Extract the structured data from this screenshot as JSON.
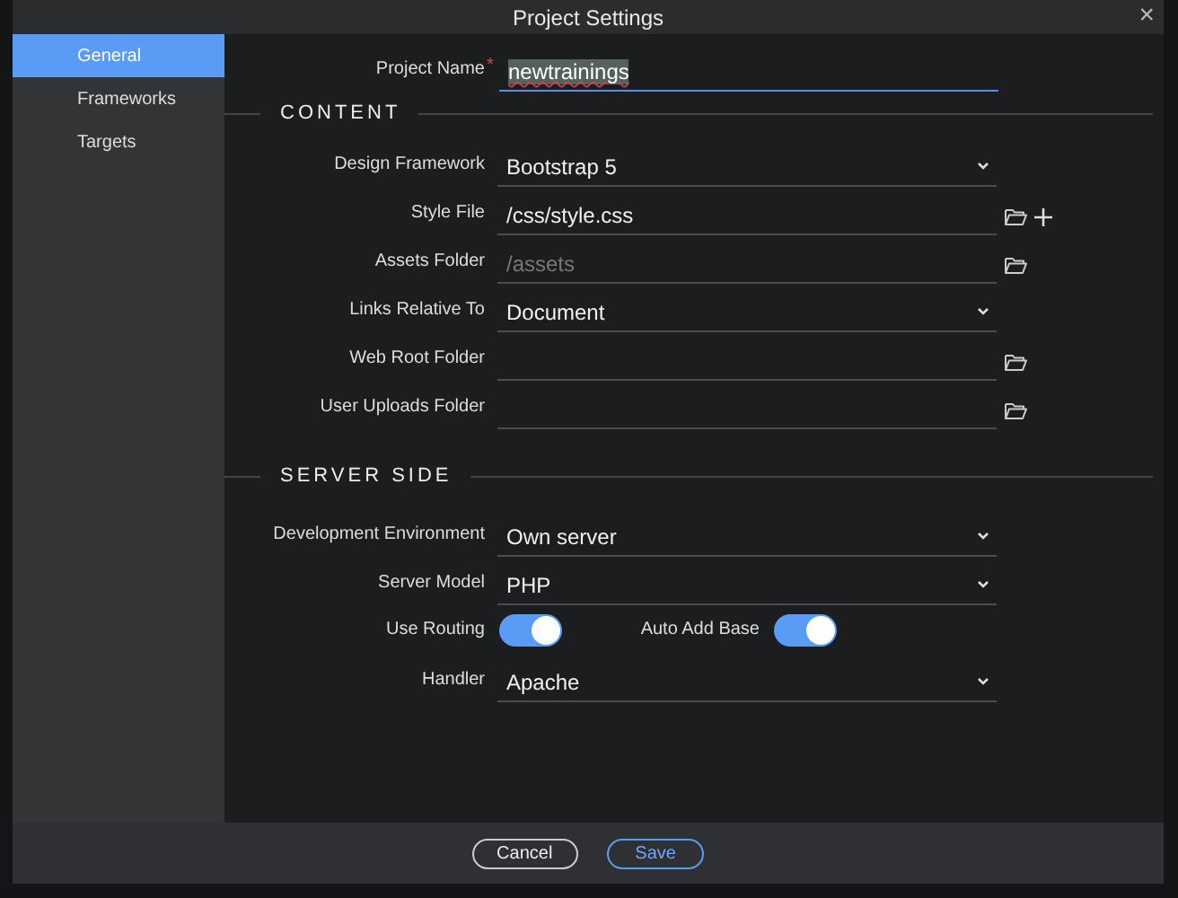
{
  "window": {
    "title": "Project Settings",
    "close": "×"
  },
  "sidebar": {
    "items": [
      {
        "label": "General",
        "selected": true
      },
      {
        "label": "Frameworks",
        "selected": false
      },
      {
        "label": "Targets",
        "selected": false
      }
    ]
  },
  "project_name": {
    "label": "Project Name",
    "required_mark": "*",
    "value": "newtrainings"
  },
  "sections": [
    {
      "title": "CONTENT",
      "rows": [
        {
          "kind": "select",
          "label": "Design Framework",
          "value": "Bootstrap 5"
        },
        {
          "kind": "file",
          "label": "Style File",
          "value": "/css/style.css",
          "addable": true
        },
        {
          "kind": "file",
          "label": "Assets Folder",
          "placeholder": "/assets",
          "addable": false
        },
        {
          "kind": "select",
          "label": "Links Relative To",
          "value": "Document"
        },
        {
          "kind": "file",
          "label": "Web Root Folder",
          "addable": false
        },
        {
          "kind": "file",
          "label": "User Uploads Folder",
          "addable": false
        }
      ]
    },
    {
      "title": "SERVER SIDE",
      "rows": [
        {
          "kind": "select",
          "label": "Development Environment",
          "value": "Own server"
        },
        {
          "kind": "select",
          "label": "Server Model",
          "value": "PHP"
        },
        {
          "kind": "toggles",
          "items": [
            {
              "label": "Use Routing",
              "on": true
            },
            {
              "label": "Auto Add Base",
              "on": true
            }
          ]
        },
        {
          "kind": "select",
          "label": "Handler",
          "value": "Apache"
        }
      ]
    }
  ],
  "buttons": [
    {
      "label": "Cancel",
      "primary": false
    },
    {
      "label": "Save",
      "primary": true
    }
  ]
}
